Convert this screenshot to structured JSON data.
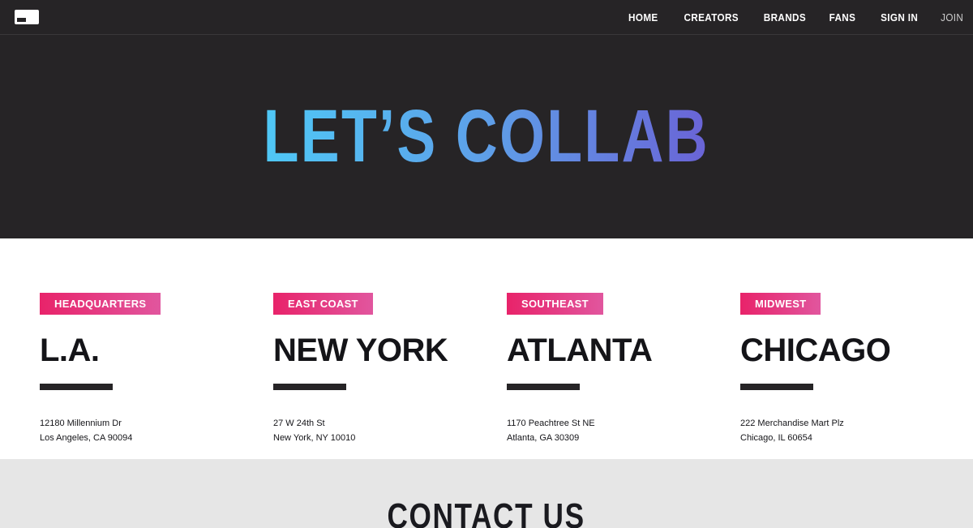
{
  "nav": {
    "items": [
      {
        "label": "HOME"
      },
      {
        "label": "CREATORS"
      },
      {
        "label": "BRANDS"
      },
      {
        "label": "FANS"
      },
      {
        "label": "SIGN IN"
      },
      {
        "label": "JOIN"
      }
    ]
  },
  "hero": {
    "title": "LET’S COLLAB"
  },
  "offices": [
    {
      "tag": "HEADQUARTERS",
      "city": "L.A.",
      "address_line1": "12180 Millennium Dr",
      "address_line2": "Los Angeles, CA 90094"
    },
    {
      "tag": "EAST COAST",
      "city": "NEW YORK",
      "address_line1": "27 W 24th St",
      "address_line2": "New York, NY 10010"
    },
    {
      "tag": "SOUTHEAST",
      "city": "ATLANTA",
      "address_line1": "1170 Peachtree St NE",
      "address_line2": "Atlanta, GA 30309"
    },
    {
      "tag": "MIDWEST",
      "city": "CHICAGO",
      "address_line1": "222 Merchandise Mart Plz",
      "address_line2": "Chicago, IL 60654"
    }
  ],
  "contact": {
    "title": "CONTACT US"
  },
  "colors": {
    "dark_bg": "#262426",
    "tag_gradient_start": "#e8236a",
    "tag_gradient_end": "#e1569e",
    "hero_gradient_start": "#4fc8f6",
    "hero_gradient_end": "#6a63d6",
    "contact_bg": "#e6e6e6"
  }
}
